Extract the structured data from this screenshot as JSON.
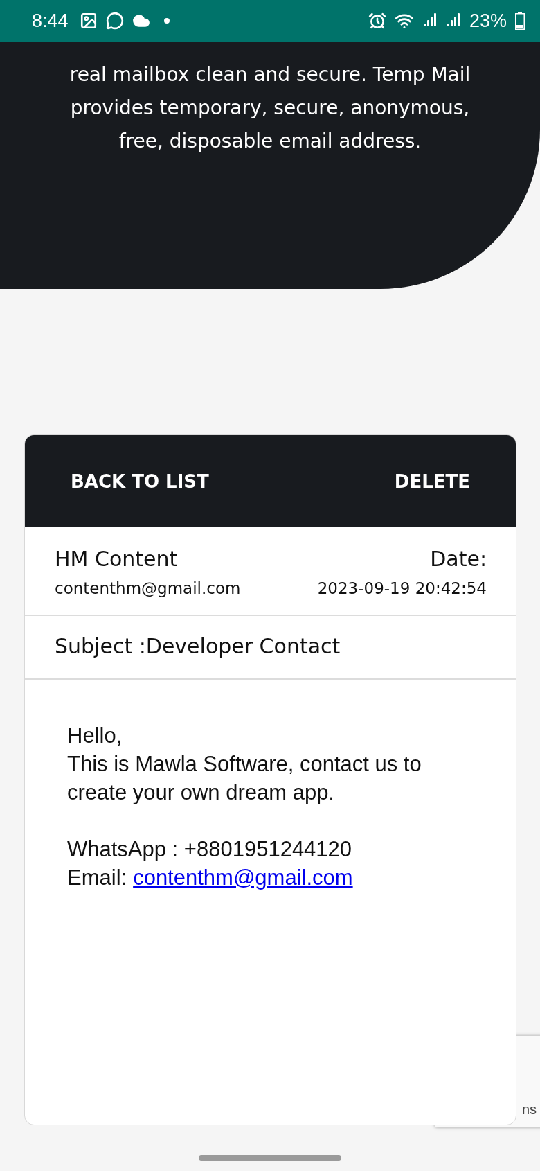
{
  "status_bar": {
    "time": "8:44",
    "battery": "23%"
  },
  "hero": {
    "lines": [
      "real mailbox clean and secure. Temp Mail",
      "provides temporary, secure, anonymous,",
      "free, disposable email address."
    ]
  },
  "message": {
    "back_button": "BACK TO LIST",
    "delete_button": "DELETE",
    "sender_name": "HM Content",
    "sender_email": "contenthm@gmail.com",
    "date_label": "Date:",
    "date": "2023-09-19 20:42:54",
    "subject": "Subject :Developer Contact",
    "body": {
      "greeting": "Hello,",
      "text": "This is Mawla Software, contact us to create your own dream app.",
      "whatsapp": "WhatsApp : +8801951244120",
      "email_label": "Email:",
      "email_link": "contenthm@gmail.com"
    }
  },
  "recaptcha_badge": {
    "text": "ns"
  }
}
